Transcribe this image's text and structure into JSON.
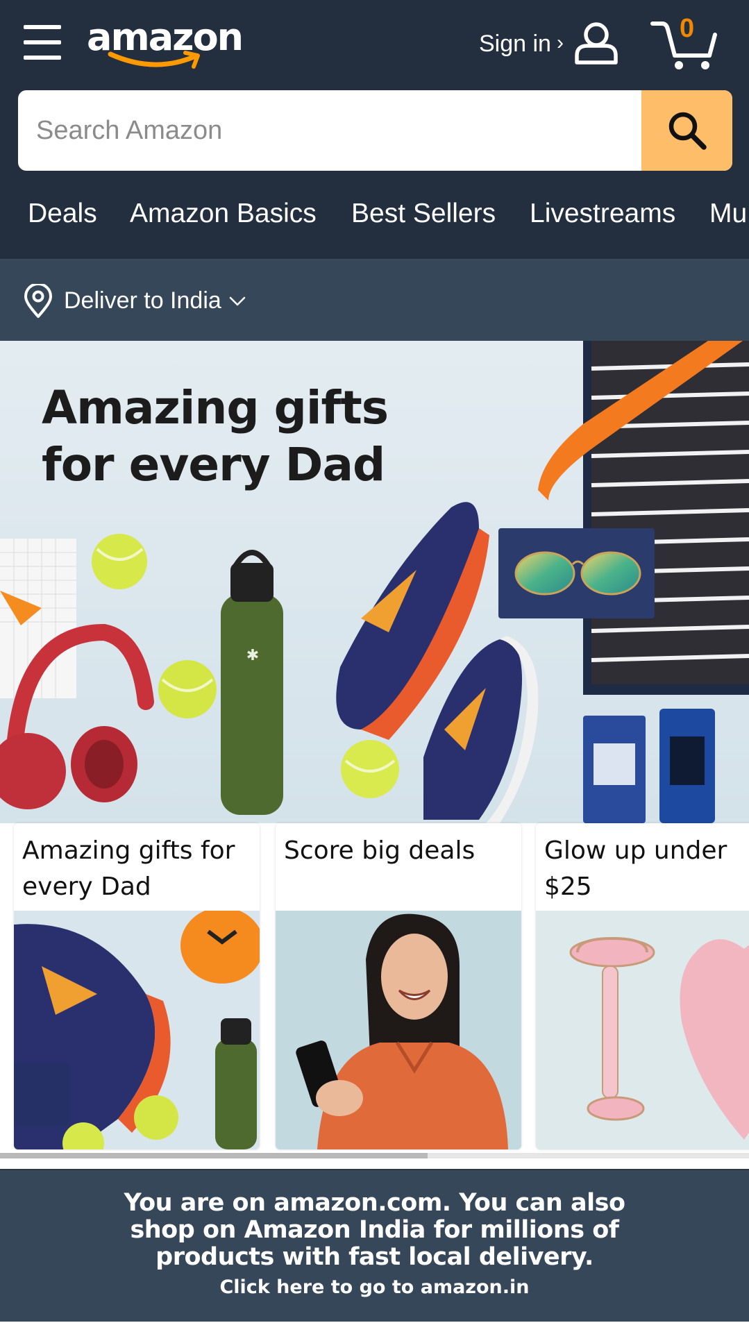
{
  "header": {
    "logo_text": "amazon",
    "signin_label": "Sign in",
    "signin_arrow": "›",
    "cart_count": "0",
    "icons": [
      "hamburger-menu-icon",
      "user-icon",
      "cart-icon",
      "search-icon"
    ]
  },
  "search": {
    "placeholder": "Search Amazon",
    "value": ""
  },
  "nav": {
    "items": [
      "Deals",
      "Amazon Basics",
      "Best Sellers",
      "Livestreams",
      "Mu"
    ]
  },
  "deliver": {
    "label": "Deliver to India"
  },
  "hero": {
    "title_line1": "Amazing gifts",
    "title_line2": "for every Dad"
  },
  "cards": [
    {
      "title": "Amazing gifts for every Dad"
    },
    {
      "title": "Score big deals"
    },
    {
      "title": "Glow up under $25"
    }
  ],
  "banner": {
    "line1": "You are on amazon.com. You can also",
    "line2": "shop on Amazon India for millions of",
    "line3": "products with fast local delivery.",
    "link": "Click here to go to amazon.in"
  },
  "colors": {
    "header_bg": "#232f3e",
    "subheader_bg": "#37475a",
    "search_button": "#febd69",
    "cart_count": "#f08804",
    "logo_smile": "#ff9900"
  }
}
